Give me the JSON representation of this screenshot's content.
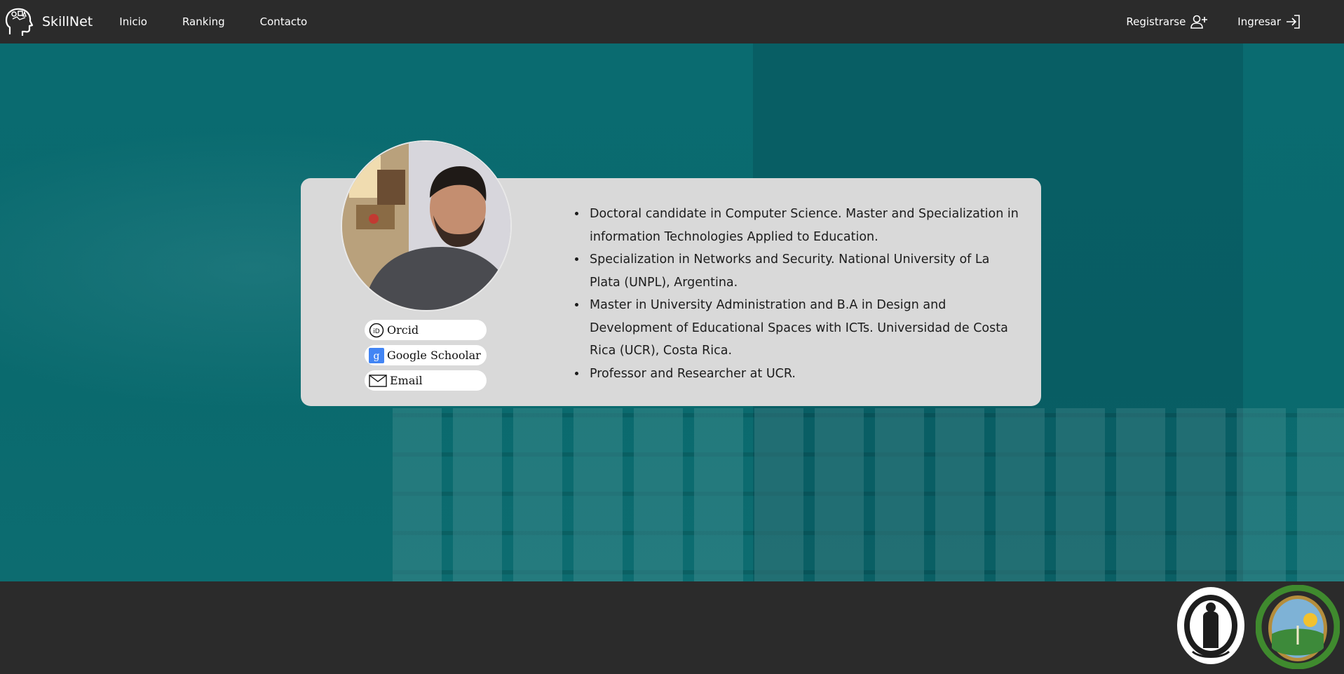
{
  "navbar": {
    "brand": "SkillNet",
    "links": [
      "Inicio",
      "Ranking",
      "Contacto"
    ],
    "register_label": "Registrarse",
    "login_label": "Ingresar"
  },
  "profile": {
    "links": [
      {
        "label": "Orcid",
        "icon": "orcid-icon"
      },
      {
        "label": "Google Schoolar",
        "icon": "google-scholar-icon"
      },
      {
        "label": "Email",
        "icon": "email-icon"
      }
    ],
    "bullets": [
      "Doctoral candidate in Computer Science. Master and Specialization in information Technologies Applied to Education.",
      "Specialization in Networks and Security. National University of La Plata (UNPL), Argentina.",
      "Master in University Administration and B.A in Design and Development of Educational Spaces with ICTs. Universidad de Costa Rica (UCR), Costa Rica.",
      "Professor and Researcher at UCR."
    ]
  },
  "colors": {
    "navbar_bg": "#2b2b2b",
    "hero_bg": "#0a6b70",
    "card_bg": "#d9d9d9",
    "scholar_blue": "#4285f4"
  }
}
